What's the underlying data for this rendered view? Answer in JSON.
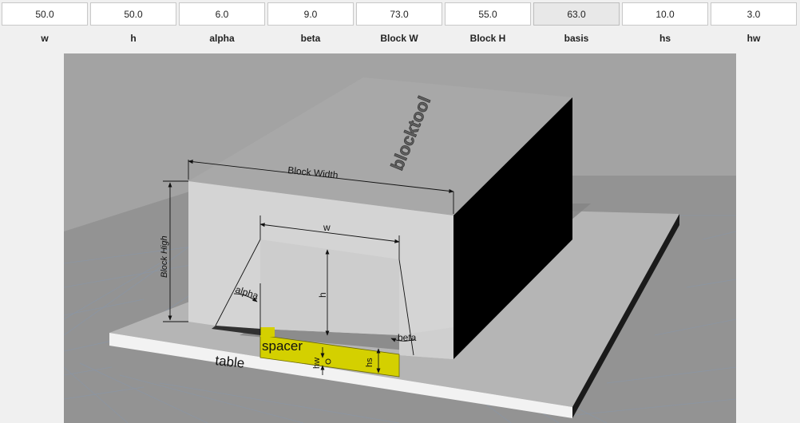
{
  "params": [
    {
      "label": "w",
      "value": "50.0"
    },
    {
      "label": "h",
      "value": "50.0"
    },
    {
      "label": "alpha",
      "value": "6.0"
    },
    {
      "label": "beta",
      "value": "9.0"
    },
    {
      "label": "Block W",
      "value": "73.0"
    },
    {
      "label": "Block H",
      "value": "55.0"
    },
    {
      "label": "basis",
      "value": "63.0"
    },
    {
      "label": "hs",
      "value": "10.0"
    },
    {
      "label": "hw",
      "value": "3.0"
    }
  ],
  "scene": {
    "block_width": "Block Width",
    "block_high": "Block High",
    "w": "w",
    "h": "h",
    "alpha": "alpha",
    "beta": "beta",
    "spacer": "spacer",
    "table": "table",
    "hs": "hs",
    "hw": "hw",
    "embossed_text": "blocktool"
  },
  "colors": {
    "viewport_bg": "#a3a3a3",
    "spacer": "#d4d000",
    "block_front": "#d4d4d4",
    "block_top": "#a8a8a8",
    "block_side": "#000000"
  }
}
